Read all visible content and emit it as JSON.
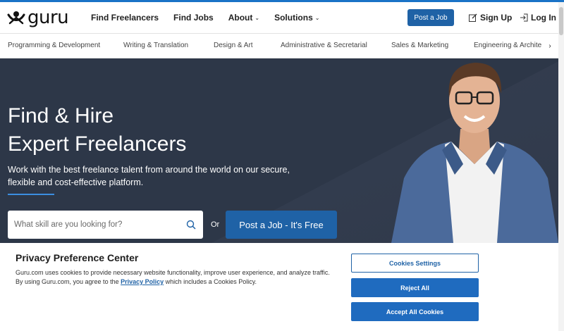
{
  "header": {
    "logo_text": "guru",
    "nav": [
      {
        "label": "Find Freelancers",
        "dropdown": false
      },
      {
        "label": "Find Jobs",
        "dropdown": false
      },
      {
        "label": "About",
        "dropdown": true
      },
      {
        "label": "Solutions",
        "dropdown": true
      }
    ],
    "post_job_label": "Post a Job",
    "signup_label": "Sign Up",
    "login_label": "Log In",
    "accent_color": "#1f62a6"
  },
  "categories": [
    "Programming & Development",
    "Writing & Translation",
    "Design & Art",
    "Administrative & Secretarial",
    "Sales & Marketing",
    "Engineering & Architect"
  ],
  "hero": {
    "title_line1": "Find & Hire",
    "title_line2": "Expert Freelancers",
    "subtitle": "Work with the best freelance talent from around the world on our secure, flexible and cost-effective platform.",
    "search_placeholder": "What skill are you looking for?",
    "or_text": "Or",
    "cta_label": "Post a Job - It's Free"
  },
  "cookie": {
    "title": "Privacy Preference Center",
    "text_before": "Guru.com uses cookies to provide necessary website functionality, improve user experience, and analyze traffic. By using Guru.com, you agree to the ",
    "link_text": "Privacy Policy",
    "text_after": " which includes a Cookies Policy.",
    "settings_label": "Cookies Settings",
    "reject_label": "Reject All",
    "accept_label": "Accept All Cookies"
  }
}
